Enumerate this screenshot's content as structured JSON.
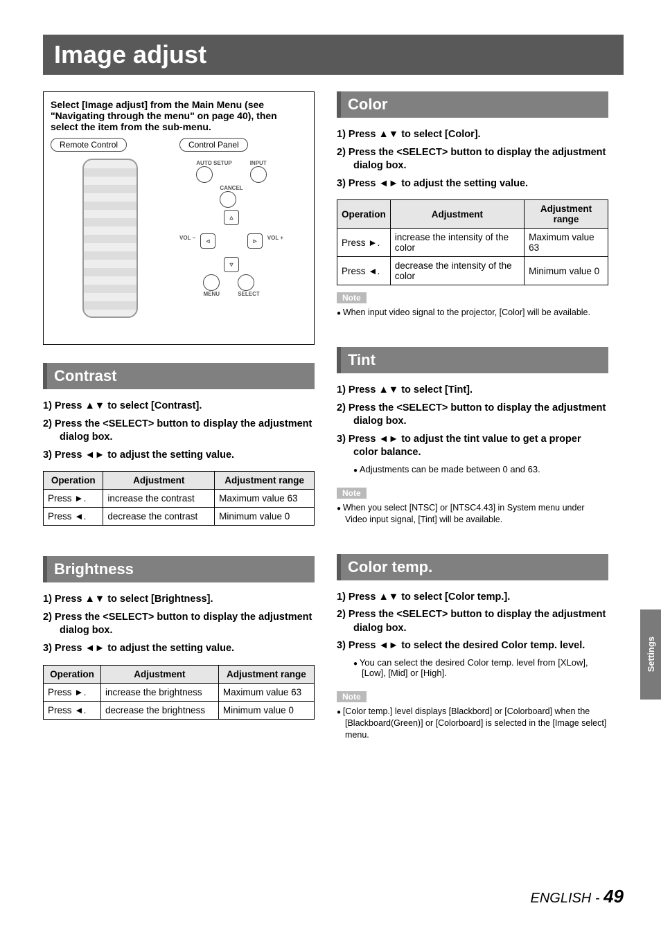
{
  "page": {
    "title": "Image adjust",
    "side_tab": "Settings",
    "footer_lang": "ENGLISH - ",
    "footer_page": "49"
  },
  "intro": {
    "text": "Select [Image adjust] from the Main Menu (see \"Navigating through the menu\" on page 40), then select the item from the sub-menu.",
    "remote_label": "Remote Control",
    "panel_label": "Control Panel",
    "panel_icons": {
      "auto_setup": "AUTO SETUP",
      "input": "INPUT",
      "cancel": "CANCEL",
      "vol_minus": "VOL −",
      "vol_plus": "VOL +",
      "menu": "MENU",
      "select": "SELECT"
    }
  },
  "sections": {
    "contrast": {
      "heading": "Contrast",
      "steps": [
        "1)  Press ▲▼ to select [Contrast].",
        "2)  Press the <SELECT> button to display the adjustment dialog box.",
        "3)  Press ◄► to adjust the setting value."
      ],
      "table": {
        "headers": [
          "Operation",
          "Adjustment",
          "Adjustment range"
        ],
        "rows": [
          [
            "Press ►.",
            "increase the contrast",
            "Maximum value 63"
          ],
          [
            "Press ◄.",
            "decrease the contrast",
            "Minimum value 0"
          ]
        ]
      }
    },
    "brightness": {
      "heading": "Brightness",
      "steps": [
        "1)  Press ▲▼ to select [Brightness].",
        "2)  Press the <SELECT> button to display the adjustment dialog box.",
        "3)  Press ◄► to adjust the setting value."
      ],
      "table": {
        "headers": [
          "Operation",
          "Adjustment",
          "Adjustment range"
        ],
        "rows": [
          [
            "Press ►.",
            "increase the brightness",
            "Maximum value 63"
          ],
          [
            "Press ◄.",
            "decrease the brightness",
            "Minimum value 0"
          ]
        ]
      }
    },
    "color": {
      "heading": "Color",
      "steps": [
        "1)  Press ▲▼ to select [Color].",
        "2)  Press the <SELECT> button to display the adjustment dialog box.",
        "3)  Press ◄► to adjust the setting value."
      ],
      "table": {
        "headers": [
          "Operation",
          "Adjustment",
          "Adjustment range"
        ],
        "rows": [
          [
            "Press ►.",
            "increase the intensity of the color",
            "Maximum value 63"
          ],
          [
            "Press ◄.",
            "decrease the intensity of the color",
            "Minimum value 0"
          ]
        ]
      },
      "note_label": "Note",
      "notes": [
        "When input video signal to the projector, [Color] will be available."
      ]
    },
    "tint": {
      "heading": "Tint",
      "steps": [
        "1)  Press ▲▼ to select [Tint].",
        "2)  Press the <SELECT> button to display the adjustment dialog box.",
        "3)  Press ◄► to adjust the tint value to get a proper color balance."
      ],
      "sub_bullets": [
        "Adjustments can be made between 0 and 63."
      ],
      "note_label": "Note",
      "notes": [
        "When you select [NTSC] or [NTSC4.43] in System menu under Video input signal, [Tint] will be available."
      ]
    },
    "colortemp": {
      "heading": "Color temp.",
      "steps": [
        "1)  Press ▲▼ to select [Color temp.].",
        "2)  Press the <SELECT> button to display the adjustment dialog box.",
        "3)  Press ◄► to select the desired Color temp. level."
      ],
      "sub_bullets": [
        "You can select the desired Color temp. level from [XLow], [Low], [Mid] or [High]."
      ],
      "note_label": "Note",
      "notes": [
        "[Color temp.] level displays [Blackbord] or [Colorboard] when the [Blackboard(Green)] or [Colorboard] is selected in the [Image select] menu."
      ]
    }
  }
}
